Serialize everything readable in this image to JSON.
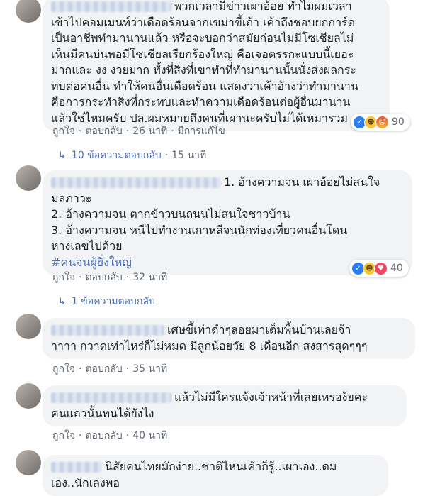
{
  "comments": [
    {
      "text_lines": [
        "พวกเวลามีข่าวเผาอ้อย ทำไมผมเวลา",
        "เข้าไปคอมเมนท์ว่าเดือดร้อนจากเขม่าขี้เถ้า เค้าถึงชอบยกการ์ด",
        "เป็นอาชีพทำมานานแล้ว หรือจะบอกว่าสมัยก่อนไม่มีโซเชียลไม่",
        "เห็นมีคนบ่นพอมีโซเชียลเรียกร้องใหญ่ คือเจอตรรกะแบบนี้เยอะ",
        "มากและ งง งวยมาก ทั้งที่สิ่งที่เขาทำที่ทำมานานนั้นนั่งส่งผลกระ",
        "ทบต่อคนอื่น ทำให้คนอื่นเดือดร้อน แสดงว่าเค้าอ้างว่าทำมานาน",
        "คือการกระทำสิ่งที่กระทบและทำความเดือดร้อนต่อผู้อื่นมานาน",
        "แล้วใช่ไหมครับ ปล.ผมหมายถึงคนที่เผานะครับไม่ได้เหมารวม"
      ],
      "like": "ถูกใจ",
      "reply": "ตอบกลับ",
      "time": "26 นาที",
      "edited": "มีการแก้ไข",
      "reaction_count": "90",
      "reply_toggle": "10 ข้อความตอบกลับ",
      "reply_time": "15 นาที"
    },
    {
      "text_lines": [
        "1. อ้างความจน เผาอ้อยไม่สนใจ",
        "มลภาวะ",
        "2. อ้างความจน ตากข้าวบนถนนไม่สนใจชาวบ้าน",
        "3. อ้างความจน หนีไปทำงานเกาหลีจนนักท่องเที่ยวคนอื่นโดน",
        "หางเลขไปด้วย"
      ],
      "hashtag": "#คนจนผู้ยิ่งใหญ่",
      "like": "ถูกใจ",
      "reply": "ตอบกลับ",
      "time": "32 นาที",
      "reaction_count": "40",
      "reply_toggle": "1 ข้อความตอบกลับ"
    },
    {
      "text_lines": [
        "เศษขี้เท่าดำๆลอยมาเต็มพื้นบ้านเลยจ้า",
        "าาาา กวาดเท่าไหร่ก็ไม่หมด มีลูกน้อยวัย 8 เดือนอีก สงสารสุดๆๆๆ"
      ],
      "like": "ถูกใจ",
      "reply": "ตอบกลับ",
      "time": "35 นาที"
    },
    {
      "text_lines": [
        "แล้วไม่มีใครแจ้งเจ้าหน้าที่เลยเหรอง้ยคะ",
        "คนแถวนั้นทนได้ยังไง"
      ],
      "like": "ถูกใจ",
      "reply": "ตอบกลับ",
      "time": "40 นาที"
    },
    {
      "text_lines": [
        "นิสัยคนไทยมักง่าย..ชาติไหนเค้าก็รู้..เผาเอง..ดม",
        "เอง..นักเลงพอ"
      ]
    }
  ]
}
